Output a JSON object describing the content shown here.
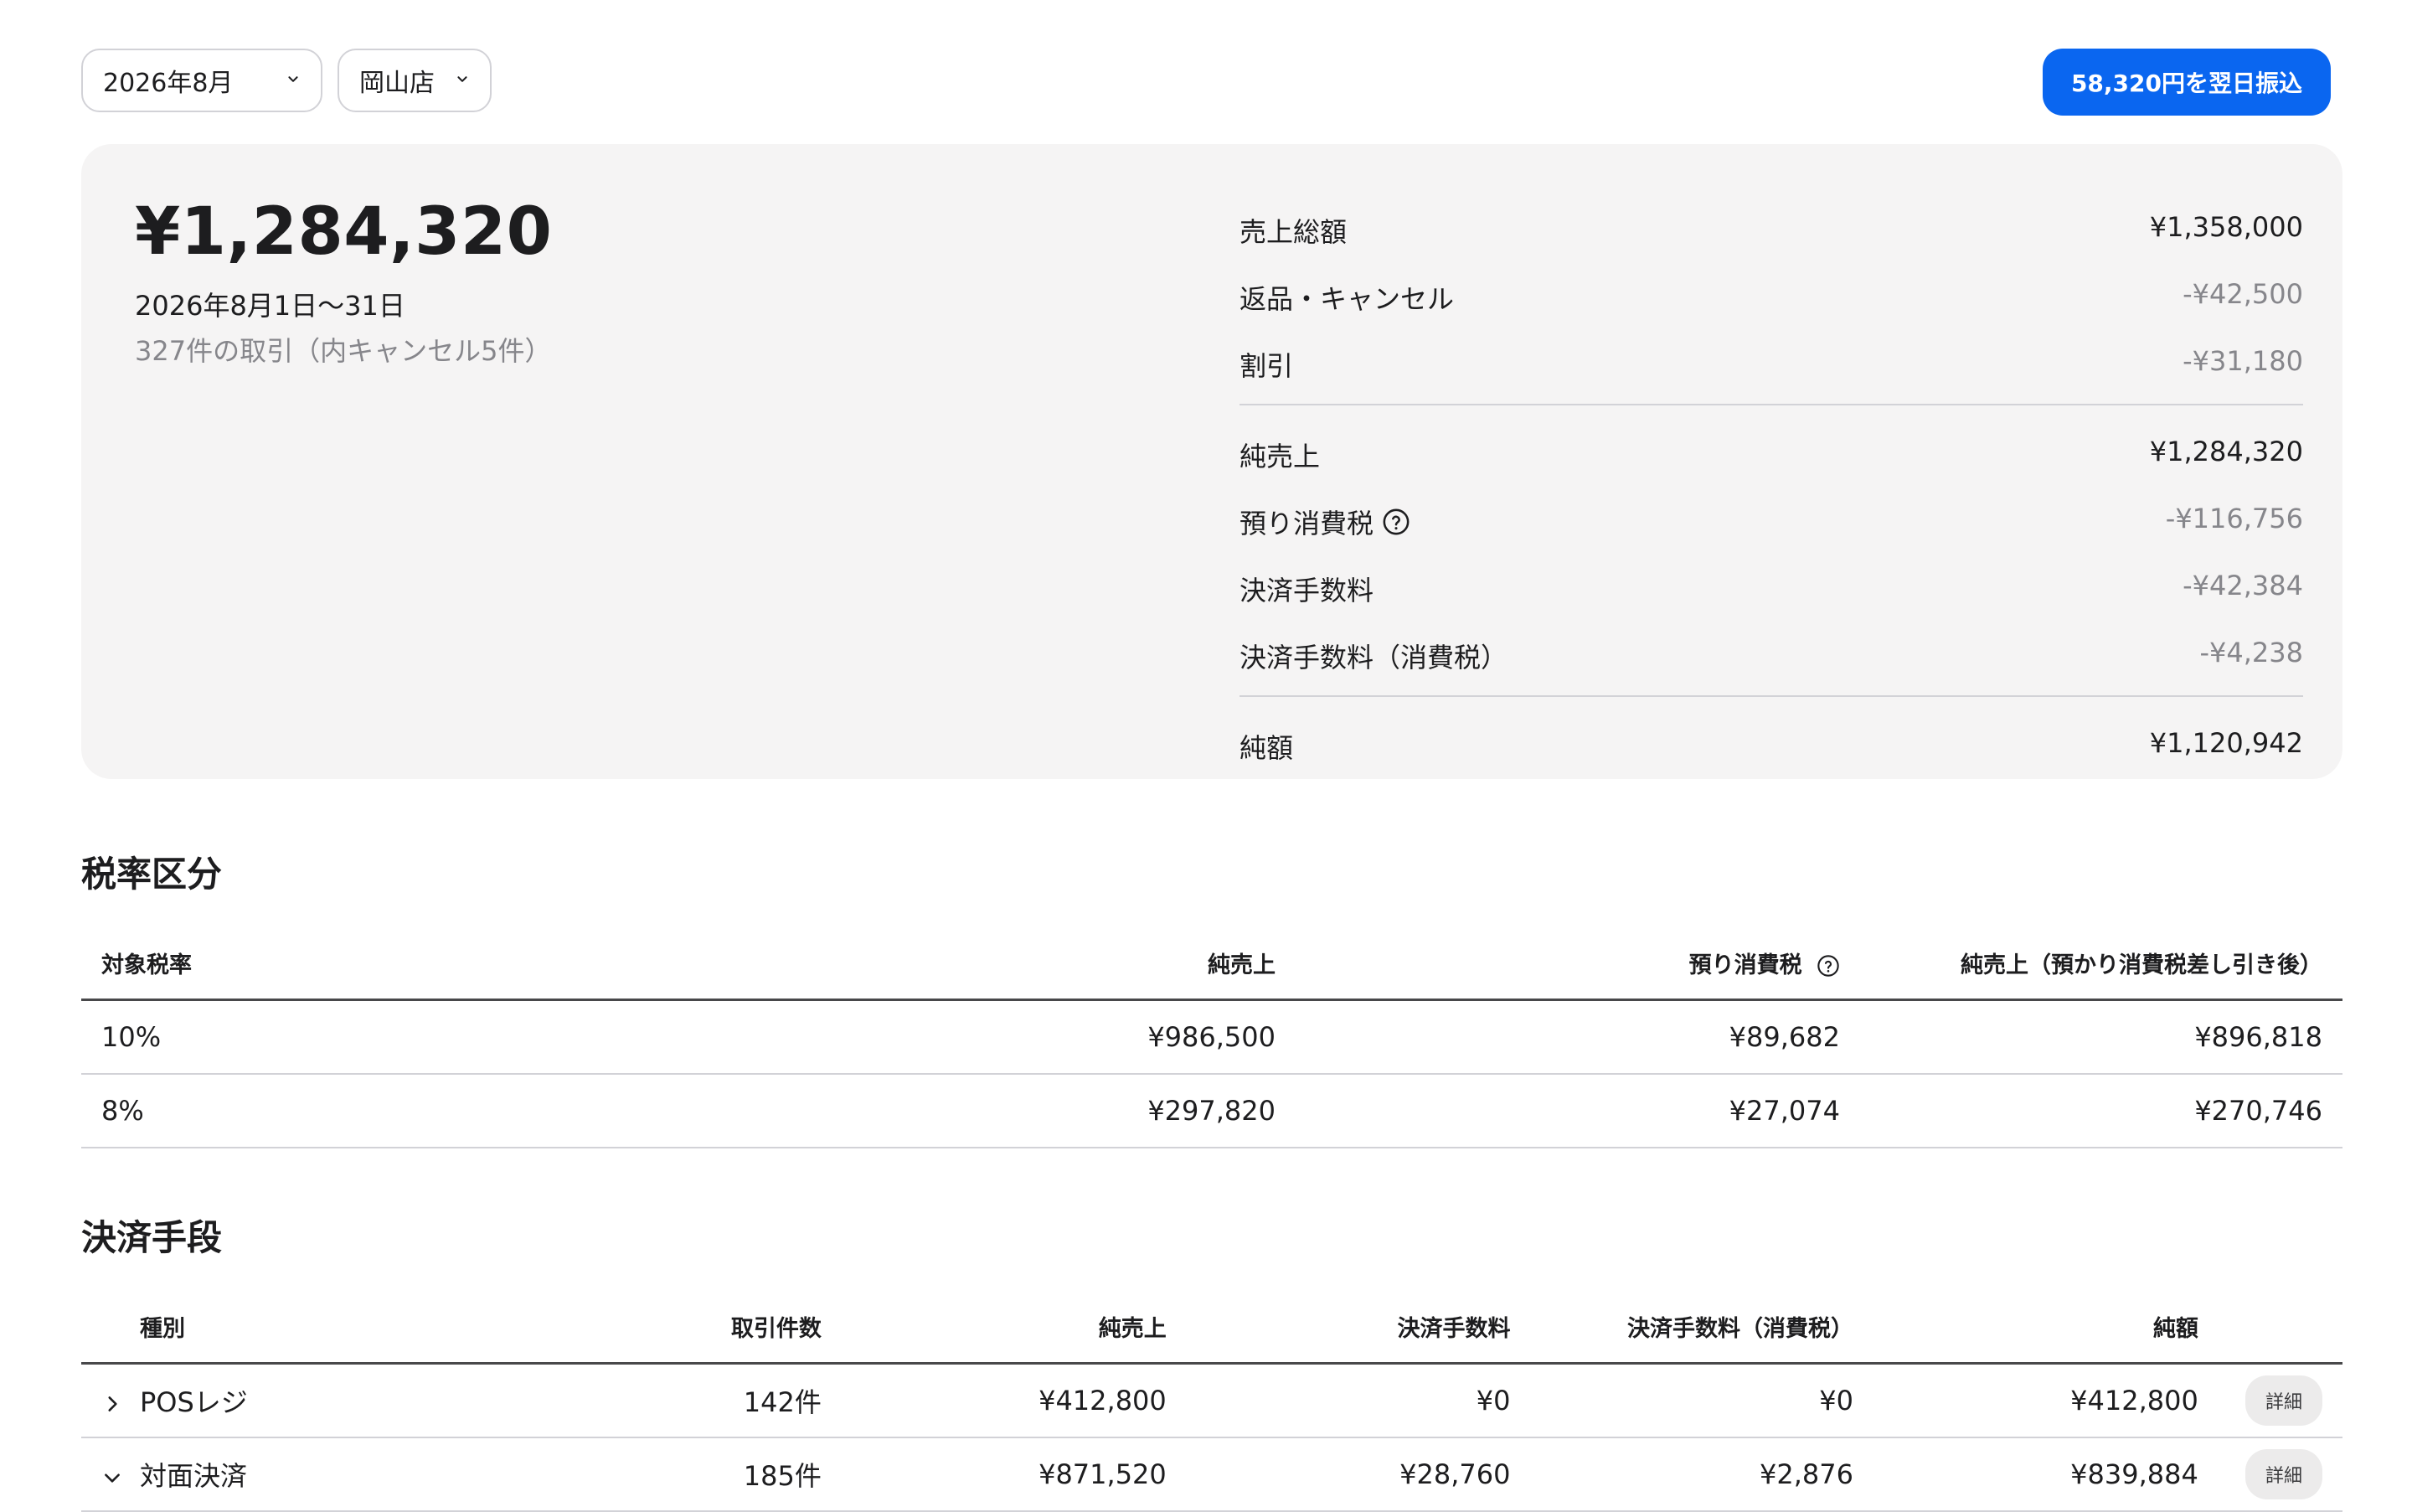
{
  "filters": {
    "month": "2026年8月",
    "store": "岡山店"
  },
  "transfer_button": "58,320円を翌日振込",
  "summary": {
    "total": "¥1,284,320",
    "period": "2026年8月1日〜31日",
    "transaction_count": "327件の取引（内キャンセル5件）",
    "rows": [
      {
        "label": "売上総額",
        "value": "¥1,358,000"
      },
      {
        "label": "返品・キャンセル",
        "value": "-¥42,500"
      },
      {
        "label": "割引",
        "value": "-¥31,180"
      },
      {
        "label": "純売上",
        "value": "¥1,284,320"
      },
      {
        "label": "預り消費税",
        "value": "-¥116,756"
      },
      {
        "label": "決済手数料",
        "value": "-¥42,384"
      },
      {
        "label": "決済手数料（消費税）",
        "value": "-¥4,238"
      },
      {
        "label": "純額",
        "value": "¥1,120,942"
      }
    ]
  },
  "tax": {
    "title": "税率区分",
    "headers": [
      "対象税率",
      "純売上",
      "預り消費税",
      "純売上（預かり消費税差し引き後）"
    ],
    "rows": [
      [
        "10%",
        "¥986,500",
        "¥89,682",
        "¥896,818"
      ],
      [
        "8%",
        "¥297,820",
        "¥27,074",
        "¥270,746"
      ]
    ]
  },
  "payment": {
    "title": "決済手段",
    "headers": [
      "種別",
      "取引件数",
      "純売上",
      "決済手数料",
      "決済手数料（消費税）",
      "純額"
    ],
    "detail_label": "詳細",
    "rows": [
      [
        "POSレジ",
        "142件",
        "¥412,800",
        "¥0",
        "¥0",
        "¥412,800"
      ],
      [
        "対面決済",
        "185件",
        "¥871,520",
        "¥28,760",
        "¥2,876",
        "¥839,884"
      ]
    ]
  },
  "icons": {
    "month_select": "chevron-down-icon",
    "store_select": "chevron-down-icon",
    "tax_help": "question-circle-icon",
    "row_collapsed": "chevron-right-icon",
    "row_expanded": "chevron-down-icon"
  },
  "colors": {
    "accent": "#0a66f0",
    "card_bg": "#f5f4f4",
    "muted": "#86868b"
  }
}
